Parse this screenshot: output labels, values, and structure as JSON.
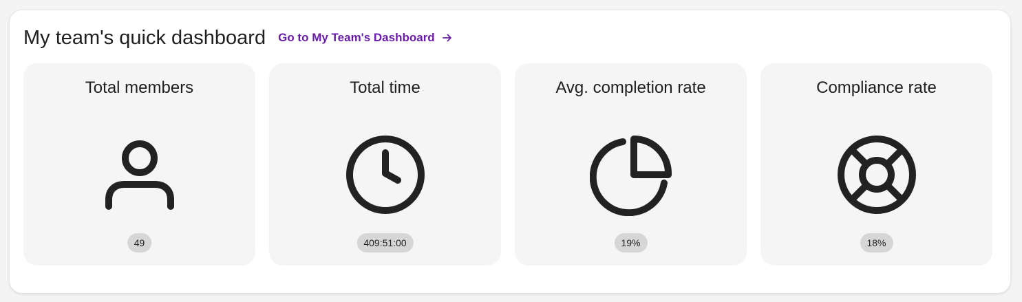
{
  "header": {
    "title": "My team's quick dashboard",
    "link_label": "Go to My Team's Dashboard",
    "link_color": "#6a1ea8"
  },
  "cards": [
    {
      "title": "Total members",
      "icon": "person-icon",
      "value": "49"
    },
    {
      "title": "Total time",
      "icon": "clock-icon",
      "value": "409:51:00"
    },
    {
      "title": "Avg. completion rate",
      "icon": "pie-chart-icon",
      "value": "19%"
    },
    {
      "title": "Compliance rate",
      "icon": "lifebuoy-icon",
      "value": "18%"
    }
  ]
}
